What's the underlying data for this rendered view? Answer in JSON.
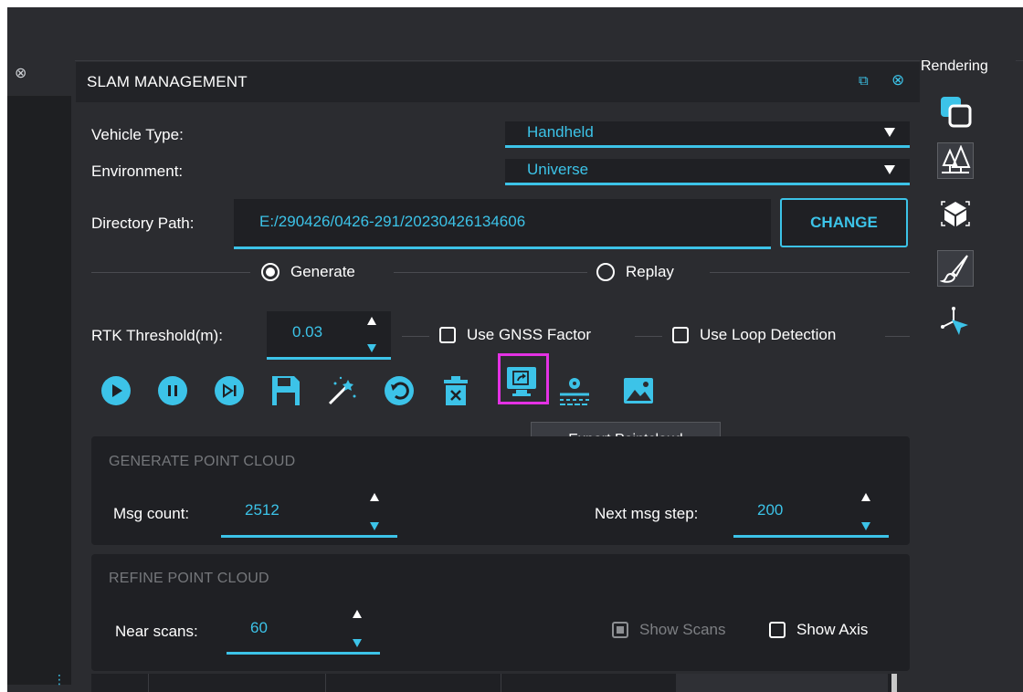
{
  "panel": {
    "title": "SLAM MANAGEMENT",
    "vehicle_type_label": "Vehicle Type:",
    "vehicle_type_value": "Handheld",
    "environment_label": "Environment:",
    "environment_value": "Universe",
    "directory_label": "Directory Path:",
    "directory_value": "E:/290426/0426-291/20230426134606",
    "change_label": "CHANGE",
    "mode_generate": "Generate",
    "mode_replay": "Replay",
    "mode_selected": "Generate",
    "rtk_label": "RTK Threshold(m):",
    "rtk_value": "0.03",
    "use_gnss_label": "Use GNSS Factor",
    "use_gnss_checked": false,
    "use_loop_label": "Use Loop Detection",
    "use_loop_checked": false
  },
  "toolbar": {
    "icons": [
      "play-icon",
      "pause-icon",
      "step-forward-icon",
      "save-icon",
      "magic-wand-icon",
      "undo-icon",
      "delete-icon",
      "export-pointcloud-icon",
      "settings-slider-icon",
      "image-icon"
    ],
    "tooltip": "Export Pointcloud"
  },
  "generate": {
    "title": "GENERATE POINT CLOUD",
    "msg_count_label": "Msg count:",
    "msg_count_value": "2512",
    "next_step_label": "Next msg step:",
    "next_step_value": "200"
  },
  "refine": {
    "title": "REFINE POINT CLOUD",
    "near_scans_label": "Near scans:",
    "near_scans_value": "60",
    "show_scans_label": "Show Scans",
    "show_scans_enabled": false,
    "show_axis_label": "Show Axis",
    "show_axis_checked": false
  },
  "rendering": {
    "title": "Rendering",
    "tools": [
      "layers-icon",
      "trees-icon",
      "cube-icon",
      "brush-icon",
      "axis-pointer-icon"
    ]
  },
  "colors": {
    "accent": "#3cc3e8",
    "highlight": "#e432e4",
    "panel_bg": "#2b2c30",
    "field_bg": "#1f2024"
  }
}
